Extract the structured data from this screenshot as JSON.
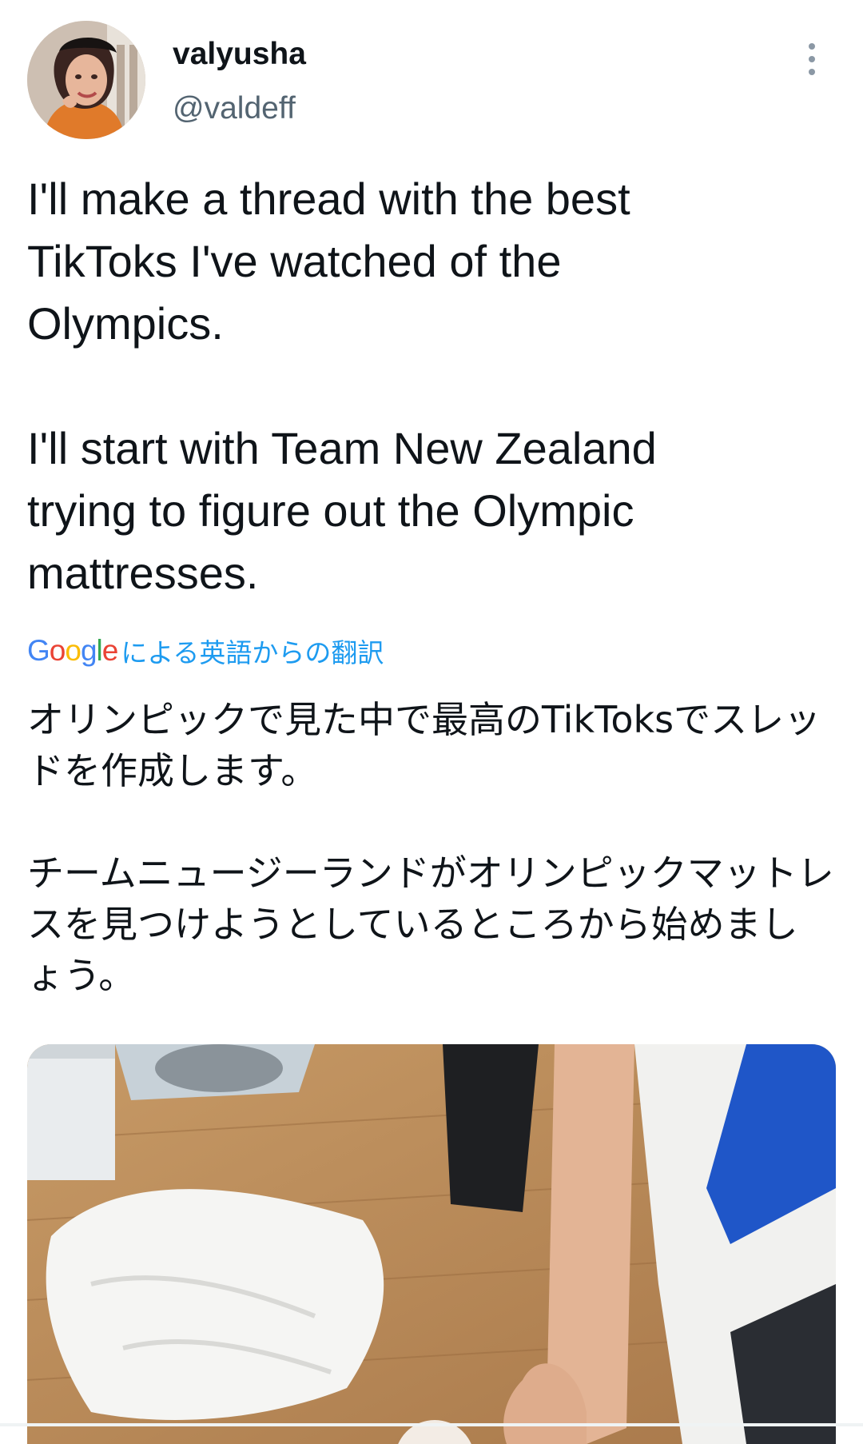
{
  "author": {
    "display_name": "valyusha",
    "handle": "@valdeff"
  },
  "header": {
    "more_icon": "more-vertical-icon"
  },
  "tweet": {
    "text_paragraphs": [
      "I'll make a thread with the best\nTikToks I've watched of the\nOlympics.",
      "I'll start with Team New Zealand\ntrying to figure out the Olympic\nmattresses."
    ]
  },
  "translation": {
    "provider_logo": "Google",
    "credit_text": "による英語からの翻訳",
    "paragraphs": [
      "オリンピックで見た中で最高のTikToksでスレッドを作成します。",
      "チームニュージーランドがオリンピックマットレスを見つけようとしているところから始めましょう。"
    ]
  },
  "media": {
    "kind": "video-thumbnail"
  },
  "colors": {
    "text": "#0f1419",
    "secondary": "#536471",
    "link": "#1d9bf0"
  }
}
